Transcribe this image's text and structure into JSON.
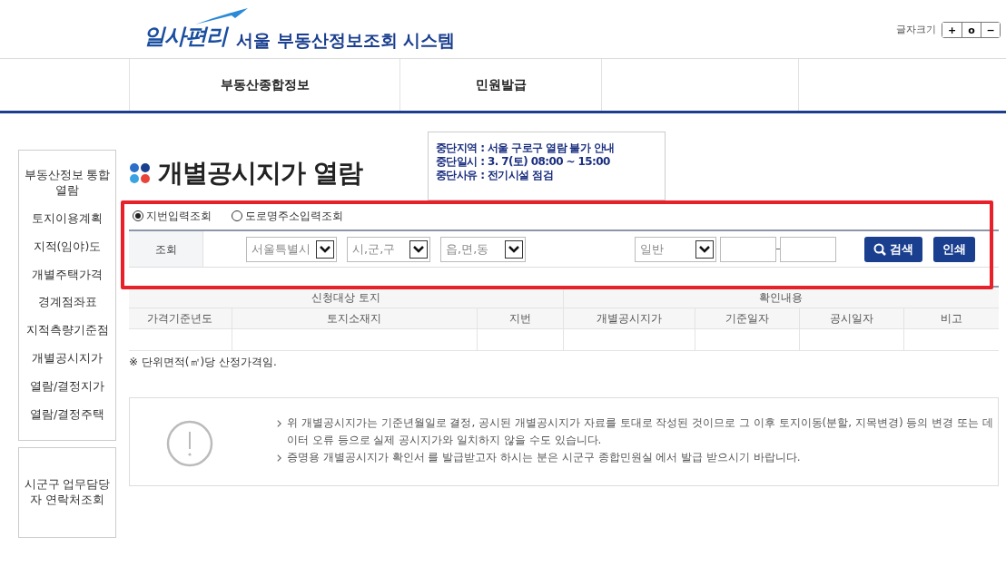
{
  "header": {
    "logo_text": "일사편리",
    "system_title": "서울 부동산정보조회 시스템",
    "font_size_label": "글자크기",
    "font_size_buttons": [
      "+",
      "o",
      "−"
    ]
  },
  "nav": {
    "items": [
      {
        "label": "부동산종합정보",
        "selected": false
      },
      {
        "label": "민원발급",
        "selected": false
      }
    ]
  },
  "sidebar": {
    "items": [
      {
        "label": "부동산정보 통합 열람"
      },
      {
        "label": "토지이용계획"
      },
      {
        "label": "지적(임야)도"
      },
      {
        "label": "개별주택가격"
      },
      {
        "label": "경계점좌표"
      },
      {
        "label": "지적측량기준점"
      },
      {
        "label": "개별공시지가"
      },
      {
        "label": "열람/결정지가"
      },
      {
        "label": "열람/결정주택"
      }
    ],
    "contact": "시군구 업무담당자 연락처조회"
  },
  "page_title": "개별공시지가 열람",
  "notice": [
    "중단지역 : 서울 구로구 열람 불가 안내",
    "중단일시 : 3. 7(토) 08:00 ~ 15:00",
    "중단사유 : 전기시설 점검"
  ],
  "search_type": [
    {
      "label": "지번입력조회",
      "selected": true
    },
    {
      "label": "도로명주소입력조회",
      "selected": false
    }
  ],
  "search": {
    "label": "조회",
    "selects": [
      "서울특별시",
      "시,군,구",
      "읍,면,동"
    ],
    "type_select": "일반",
    "buttons": [
      "검색",
      "인쇄"
    ]
  },
  "table": {
    "groups": [
      {
        "label": "신청대상 토지"
      },
      {
        "label": "확인내용"
      }
    ],
    "columns": [
      "가격기준년도",
      "토지소재지",
      "지번",
      "개별공시지가",
      "기준일자",
      "공시일자",
      "비고"
    ]
  },
  "unit_note": "※ 단위면적(㎡)당 산정가격임.",
  "info": [
    "위 개별공시지가는 기준년월일로 결정, 공시된 개별공시지가 자료를 토대로 작성된 것이므로 그 이후 토지이동(분할, 지목변경) 등의 변경 또는 데이터 오류 등으로 실제 공시지가와 일치하지 않을 수도 있습니다.",
    "증명용 개별공시지가 확인서 를 발급받고자 하시는 분은 시군구 종합민원실 에서 발급 받으시기 바랍니다."
  ]
}
